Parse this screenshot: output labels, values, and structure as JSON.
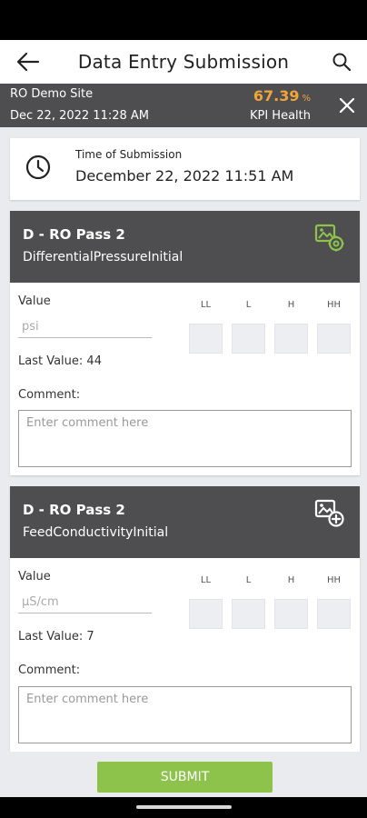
{
  "app_bar": {
    "title": "Data Entry Submission"
  },
  "site_bar": {
    "site_name": "RO Demo Site",
    "datetime": "Dec 22, 2022 11:28 AM",
    "kpi_value": "67.39",
    "kpi_unit": "%",
    "kpi_label": "KPI Health"
  },
  "time_card": {
    "label": "Time of Submission",
    "value": "December 22, 2022 11:51 AM"
  },
  "entries": [
    {
      "title": "D - RO Pass 2",
      "parameter": "DifferentialPressureInitial",
      "image_icon": "image-settings-icon",
      "value_label": "Value",
      "unit_placeholder": "psi",
      "limits": [
        "LL",
        "L",
        "H",
        "HH"
      ],
      "last_value": "Last Value: 44",
      "comment_label": "Comment:",
      "comment_placeholder": "Enter comment here"
    },
    {
      "title": "D - RO Pass 2",
      "parameter": "FeedConductivityInitial",
      "image_icon": "image-add-icon",
      "value_label": "Value",
      "unit_placeholder": "µS/cm",
      "limits": [
        "LL",
        "L",
        "H",
        "HH"
      ],
      "last_value": "Last Value: 7",
      "comment_label": "Comment:",
      "comment_placeholder": "Enter comment here"
    }
  ],
  "submit_label": "SUBMIT",
  "colors": {
    "header_dark": "#4e4e50",
    "kpi_accent": "#f0a43a",
    "submit_green": "#8dc34a",
    "icon_green": "#8dc34a"
  }
}
